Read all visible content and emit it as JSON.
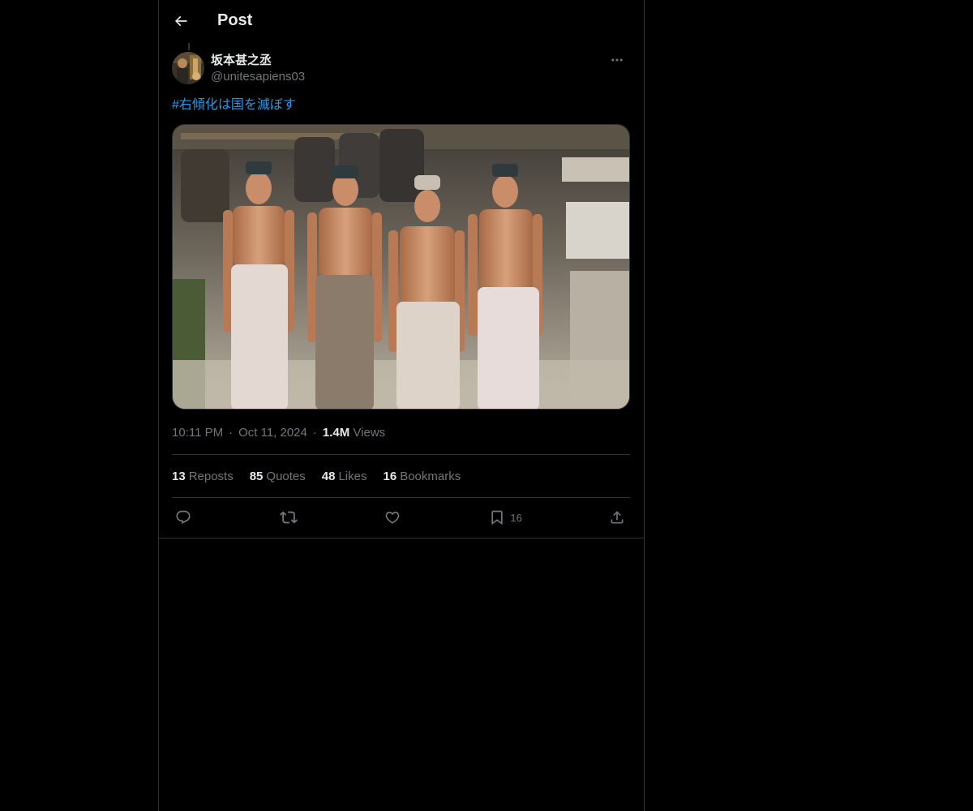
{
  "header": {
    "title": "Post"
  },
  "author": {
    "name": "坂本甚之丞",
    "handle": "@unitesapiens03"
  },
  "post": {
    "hashtag": "#右傾化は国を滅ぼす"
  },
  "meta": {
    "time": "10:11 PM",
    "date": "Oct 11, 2024",
    "views_count": "1.4M",
    "views_label": "Views"
  },
  "stats": {
    "reposts_count": "13",
    "reposts_label": "Reposts",
    "quotes_count": "85",
    "quotes_label": "Quotes",
    "likes_count": "48",
    "likes_label": "Likes",
    "bookmarks_count": "16",
    "bookmarks_label": "Bookmarks"
  },
  "actions": {
    "bookmark_count": "16"
  },
  "colors": {
    "background": "#000000",
    "text": "#e7e9ea",
    "muted": "#71767b",
    "link": "#1d9bf0",
    "border": "#2f3336"
  },
  "icons": {
    "back": "arrow-left-icon",
    "more": "more-horizontal-icon",
    "reply": "reply-icon",
    "repost": "repost-icon",
    "like": "heart-icon",
    "bookmark": "bookmark-icon",
    "share": "share-icon"
  }
}
